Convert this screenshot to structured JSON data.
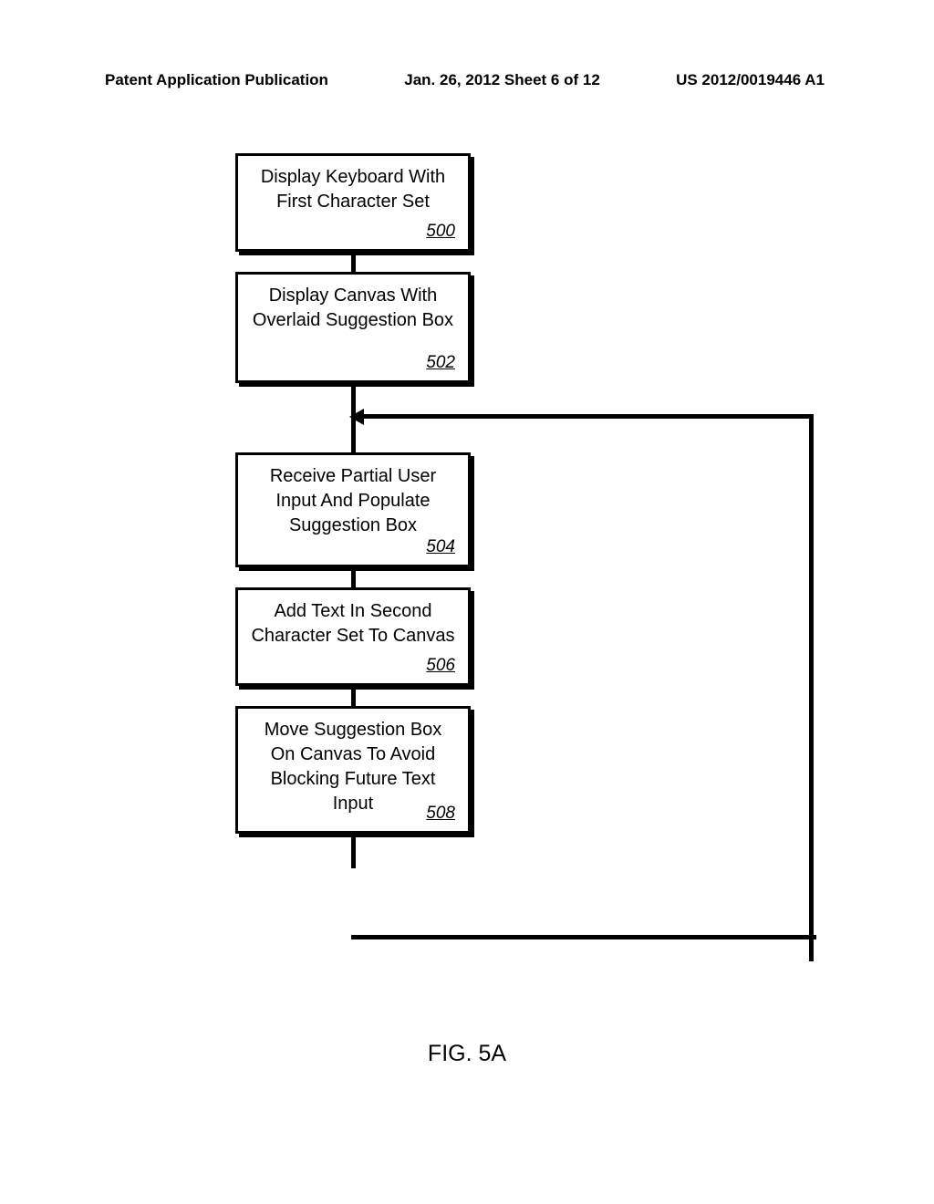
{
  "header": {
    "left": "Patent Application Publication",
    "center": "Jan. 26, 2012  Sheet 6 of 12",
    "right": "US 2012/0019446 A1"
  },
  "boxes": [
    {
      "text": "Display Keyboard With First Character Set",
      "ref": "500"
    },
    {
      "text": "Display Canvas With Overlaid Suggestion Box",
      "ref": "502"
    },
    {
      "text": "Receive Partial User Input And Populate Suggestion Box",
      "ref": "504"
    },
    {
      "text": "Add Text In Second Character Set To Canvas",
      "ref": "506"
    },
    {
      "text": "Move Suggestion Box On Canvas To Avoid Blocking Future Text Input",
      "ref": "508"
    }
  ],
  "figure": "FIG. 5A"
}
